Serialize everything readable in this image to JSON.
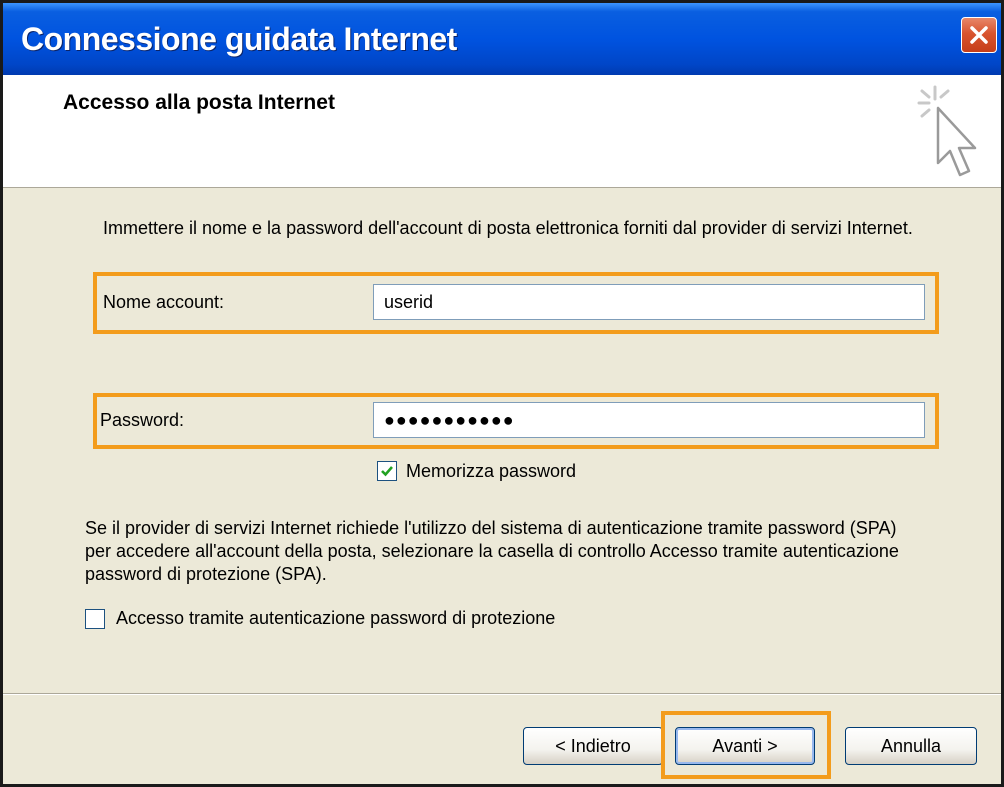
{
  "window": {
    "title": "Connessione guidata Internet"
  },
  "header": {
    "title": "Accesso alla posta Internet",
    "icon": "wizard-cursor-icon"
  },
  "intro_text": "Immettere il nome e la password dell'account di posta elettronica forniti dal provider di servizi Internet.",
  "account": {
    "label": "Nome account:",
    "value": "userid"
  },
  "password": {
    "label": "Password:",
    "value": "●●●●●●●●●●●"
  },
  "remember_password": {
    "label": "Memorizza password",
    "checked": true
  },
  "spa": {
    "description": "Se il provider di servizi Internet richiede l'utilizzo del sistema di autenticazione tramite password (SPA) per accedere all'account della posta, selezionare la casella di controllo Accesso tramite autenticazione password di protezione (SPA).",
    "checkbox_label": "Accesso tramite autenticazione password di protezione",
    "checked": false
  },
  "buttons": {
    "back": "< Indietro",
    "next": "Avanti >",
    "cancel": "Annulla"
  },
  "colors": {
    "titlebar": "#0053e0",
    "highlight": "#f39c1c",
    "dialog_bg": "#ece9d8",
    "check": "#21a121"
  }
}
